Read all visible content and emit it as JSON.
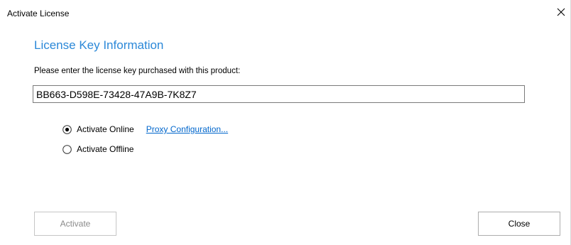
{
  "window": {
    "title": "Activate License"
  },
  "content": {
    "heading": "License Key Information",
    "instruction": "Please enter the license key purchased with this product:",
    "license_key": "BB663-D598E-73428-47A9B-7K8Z7"
  },
  "activation_mode": {
    "online_label": "Activate Online",
    "offline_label": "Activate Offline",
    "selected": "online",
    "proxy_link_label": "Proxy Configuration..."
  },
  "buttons": {
    "activate_label": "Activate",
    "close_label": "Close"
  },
  "colors": {
    "heading": "#2b88d8",
    "link": "#0066cc",
    "disabled_text": "#8a8a8a"
  }
}
